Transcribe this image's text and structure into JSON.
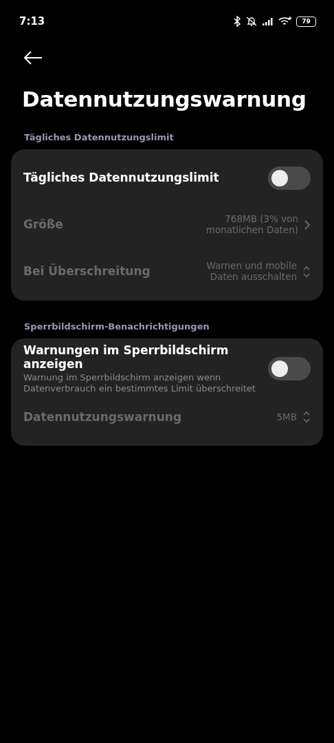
{
  "status_bar": {
    "time": "7:13",
    "battery": "79"
  },
  "title": "Datennutzungswarnung",
  "sections": [
    {
      "header": "Tägliches Datennutzungslimit",
      "rows": [
        {
          "kind": "toggle",
          "label": "Tägliches Datennutzungslimit",
          "on": false,
          "disabled": false
        },
        {
          "kind": "link",
          "label": "Größe",
          "value": "768MB (3% von monatlichen Daten)",
          "disabled": true
        },
        {
          "kind": "select",
          "label": "Bei Überschreitung",
          "value": "Warnen und mobile Daten ausschalten",
          "disabled": true
        }
      ]
    },
    {
      "header": "Sperrbildschirm-Benachrichtigungen",
      "rows": [
        {
          "kind": "toggle",
          "label": "Warnungen im Sperrbildschirm anzeigen",
          "description": "Warnung im Sperrbildschirm anzeigen wenn Datenverbrauch ein bestimmtes Limit überschreitet",
          "on": false,
          "disabled": false
        },
        {
          "kind": "select",
          "label": "Datennutzungswarnung",
          "value": "5MB",
          "disabled": true
        }
      ]
    }
  ]
}
